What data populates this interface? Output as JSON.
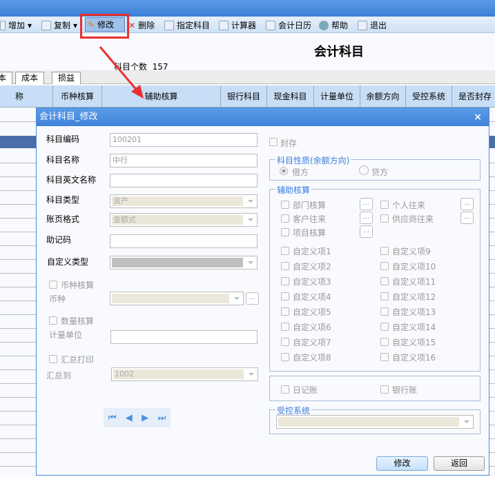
{
  "toolbar": {
    "add": "增加",
    "copy": "复制",
    "edit": "修改",
    "delete": "删除",
    "assign": "指定科目",
    "calculator": "计算器",
    "calendar": "会计日历",
    "help": "帮助",
    "exit": "退出"
  },
  "page": {
    "title": "会计科目",
    "count_label": "科目个数",
    "count": "157"
  },
  "tabs": [
    "本",
    "成本",
    "损益"
  ],
  "grid": {
    "columns": [
      "称",
      "币种核算",
      "辅助核算",
      "银行科目",
      "现金科目",
      "计量单位",
      "余额方向",
      "受控系统",
      "是否封存"
    ]
  },
  "dialog": {
    "title": "会计科目_修改",
    "fields": {
      "code_label": "科目编码",
      "code": "100201",
      "name_label": "科目名称",
      "name": "中行",
      "en_label": "科目英文名称",
      "type_label": "科目类型",
      "type": "资产",
      "format_label": "账页格式",
      "format": "金额式",
      "mnemonic_label": "助记码",
      "custom_label": "自定义类型",
      "currency_check": "币种核算",
      "currency_label": "币种",
      "qty_check": "数量核算",
      "unit_label": "计量单位",
      "sum_check": "汇总打印",
      "sum_to_label": "汇总到",
      "sum_to": "1002"
    },
    "sealed": "封存",
    "nature": {
      "legend": "科目性质(余额方向)",
      "debit": "借方",
      "credit": "贷方",
      "selected": "借方"
    },
    "aux": {
      "legend": "辅助核算",
      "items": [
        "部门核算",
        "个人往来",
        "客户往来",
        "供应商往来",
        "项目核算"
      ],
      "custom": [
        "自定义项1",
        "自定义项9",
        "自定义项2",
        "自定义项10",
        "自定义项3",
        "自定义项11",
        "自定义项4",
        "自定义项12",
        "自定义项5",
        "自定义项13",
        "自定义项6",
        "自定义项14",
        "自定义项7",
        "自定义项15",
        "自定义项8",
        "自定义项16"
      ]
    },
    "journal": "日记账",
    "bank": "银行账",
    "controlled": {
      "legend": "受控系统"
    },
    "ok": "修改",
    "back": "返回",
    "close": "×"
  }
}
